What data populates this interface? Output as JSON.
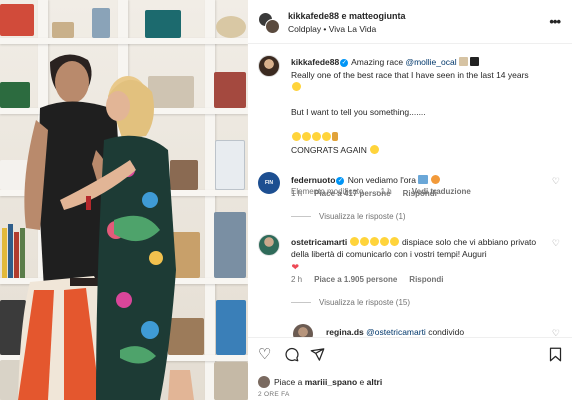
{
  "header": {
    "title": "kikkafede88 e matteogiunta",
    "subtitle": "Coldplay • Viva La Vida"
  },
  "caption": {
    "username": "kikkafede88",
    "line1_text": " Amazing race ",
    "mention": "@mollie_ocal",
    "line2": "Really one of the best race that I have seen in the last 14 years",
    "line3": "But I want to tell you something.......",
    "line4": "CONGRATS AGAIN",
    "meta_edited": "Elemento modificato",
    "meta_time": "· 1 h",
    "meta_translate": "Vedi traduzione"
  },
  "comments": [
    {
      "username": "federnuoto",
      "text": " Non vediamo l'ora",
      "avatar_text": "FIN",
      "time": "1 h",
      "likes": "Piace a 417 persone",
      "reply": "Rispondi",
      "view_replies": "Visualizza le risposte (1)"
    },
    {
      "username": "ostetricamarti",
      "text": " dispiace solo che vi abbiano privato della libertà di comunicarlo con i vostri tempi! Auguri",
      "time": "2 h",
      "likes": "Piace a 1.905 persone",
      "reply": "Rispondi",
      "view_replies": "Visualizza le risposte (15)"
    },
    {
      "username": "regina.ds",
      "mention": "@ostetricamarti",
      "text": " condivido"
    }
  ],
  "actions": {
    "likes_prefix": "Piace a ",
    "likes_user": "mariii_spano",
    "likes_and": " e ",
    "likes_others": "altri",
    "time": "2 ORE FA"
  },
  "icons": {
    "more": "more-horizontal-icon",
    "like": "heart-icon",
    "comment": "comment-icon",
    "share": "send-icon",
    "save": "bookmark-icon"
  },
  "colors": {
    "link": "#00376b",
    "verified": "#0095f6",
    "muted": "#737373",
    "heart": "#ed4956"
  }
}
